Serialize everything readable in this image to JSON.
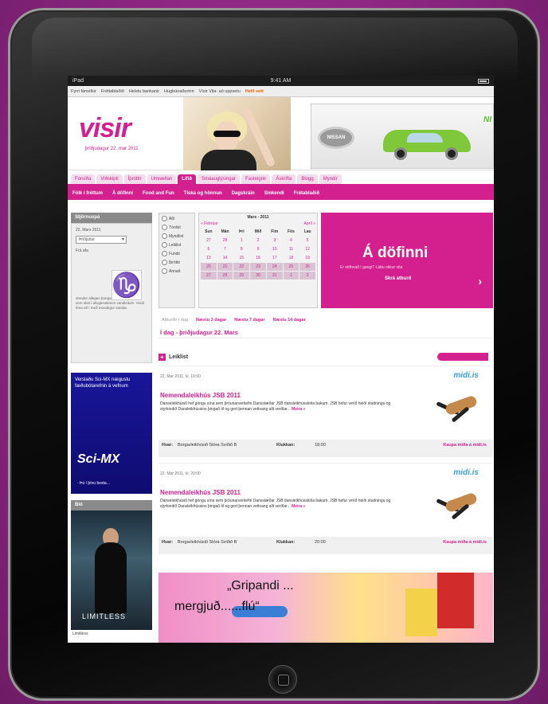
{
  "status_bar": {
    "carrier": "iPad",
    "time": "9:41 AM"
  },
  "bookmarks": [
    "Fyrri fánstíkir",
    "Fréttablaðið",
    "Helstu bankanir",
    "Hugbúnaðurinn",
    "Vísir Vila- að uppsetu",
    "Heill sett"
  ],
  "header": {
    "logo": "visir",
    "date": "þriðjudagur 22. mar 2011",
    "ad_letter": "NI"
  },
  "nav_primary": [
    {
      "label": "Forsíða"
    },
    {
      "label": "Viðskipti"
    },
    {
      "label": "Íþróttir"
    },
    {
      "label": "Umræðan"
    },
    {
      "label": "Lífið",
      "active": true
    },
    {
      "label": "Smáauglýsingar"
    },
    {
      "label": "Fasteignir"
    },
    {
      "label": "Áskrifta"
    },
    {
      "label": "Blogg"
    },
    {
      "label": "Myndir"
    }
  ],
  "nav_secondary": [
    "Fólk í fréttum",
    "Á döfinni",
    "Food and Fun",
    "Tíska og hönnun",
    "Dagskráin",
    "Sinkendi",
    "Frétablaðið"
  ],
  "left": {
    "filter_title": "Stjörnuspá",
    "filter_date": "22. Mars 2011",
    "filter_select": "Þriðjudur",
    "filter_label": "Frá afa",
    "filter_text": "stendur allegen þungum í verkum og öutt sem skal í alloglesekmen vandleitum. Verið tíma eð í með mendegur vandar.",
    "ad_text": "Verslaðu Sci-MX nægustu fæðubótarefnin á vefnum",
    "ad_brand": "Sci-MX",
    "ad_sub": "- Þú í þínu besta...",
    "bio_title": "Bíó",
    "poster_title": "LIMITLESS",
    "poster_caption": "Limitless"
  },
  "calendar": {
    "types": [
      "Allt",
      "Tónlist",
      "Myndlist",
      "Leiklist",
      "Fundir",
      "Íþróttir",
      "Annað"
    ],
    "month": "Mars - 2011",
    "prev": "« Febrúar",
    "next": "Apríl »",
    "day_headers": [
      "Sun",
      "Mán",
      "Þri",
      "Mið",
      "Fim",
      "Fös",
      "Lau"
    ],
    "days": [
      "27",
      "28",
      "1",
      "2",
      "3",
      "4",
      "5",
      "6",
      "7",
      "8",
      "9",
      "10",
      "11",
      "12",
      "13",
      "14",
      "15",
      "16",
      "17",
      "18",
      "19",
      "20",
      "21",
      "22",
      "23",
      "24",
      "25",
      "26",
      "27",
      "28",
      "29",
      "30",
      "31",
      "1",
      "2"
    ]
  },
  "dofinni_ad": {
    "title": "Á döfinni",
    "subtitle": "Er eitthvað í gangi? Láttu okkur vita",
    "cta": "Skrá atburð",
    "arrow": "›"
  },
  "ranges": [
    {
      "label": "Atburðir í dag",
      "muted": true
    },
    {
      "label": "Næstu 3 dagar"
    },
    {
      "label": "Næstu 7 dagar"
    },
    {
      "label": "Næstu 14 dagar"
    }
  ],
  "today_heading": "Í dag - þriðjudagur 22. Mars",
  "category": {
    "label": "Leiklist",
    "plus": "+"
  },
  "events": [
    {
      "date": "22. Mar 2011, kl. 19:00",
      "brand": "midi.is",
      "title": "Nemendaleikhús JSB 2011",
      "desc": "Danseleikhúsið hef göngu sína sem þróunarverkefni Dansstæðar JSB dansleikhússkóla bakum. JSB hefur verið heiði studningu og styrkindið Dansleikhússins þingað til og gert þennan vettvang allt verðlar...",
      "more": "Meira »",
      "place_label": "Hvar:",
      "place": "Borgarleikhúsið Stóra Sviðið B",
      "time_label": "Klukkan:",
      "time": "18:00",
      "buy": "Kaupa miða á midi.is"
    },
    {
      "date": "22. Mar 2011, kl. 20:00",
      "brand": "midi.is",
      "title": "Nemendaleikhús JSB 2011",
      "desc": "Danseleikhúsið hef göngu sína sem þróunarverkefni Dansstæðar JSB dansleikhússkóla bakum. JSB hefur verið heiði studningu og styrkindið Dansleikhússins þingað til og gert þennan vettvang allt verðlar...",
      "more": "Meira »",
      "place_label": "Hvar:",
      "place": "Borgarleikhúsið Stóra Sviðið B",
      "time_label": "Klukkan:",
      "time": "20:00",
      "buy": "Kaupa miða á midi.is"
    }
  ],
  "bottom_ad": {
    "line1": "„Gripandi ...",
    "line2": "mergjuð......flú“"
  },
  "colors": {
    "brand": "#d4208f",
    "backdrop": "#8e2a82",
    "ad_blue": "#19169a"
  }
}
